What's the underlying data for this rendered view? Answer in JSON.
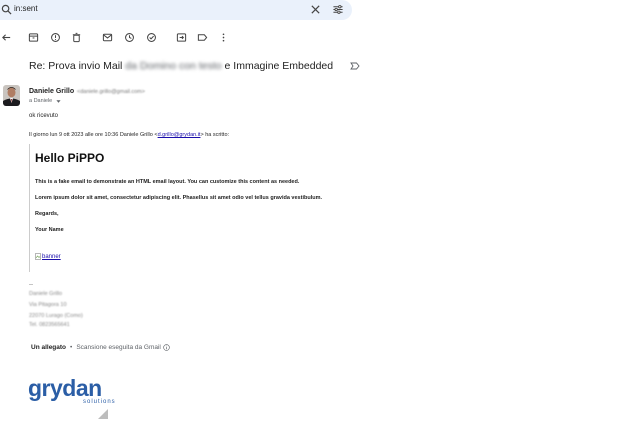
{
  "search": {
    "query": "in:sent"
  },
  "email": {
    "subject": {
      "part1": "Re: Prova invio Mail",
      "part2_obscured": "da Domino con testo",
      "part3": "e Immagine Embedded"
    },
    "sender": {
      "name": "Daniele Grillo",
      "email": "<daniele.grillo@gmail.com>"
    },
    "recipient": "a Daniele",
    "reply_body": "ok ricevuto",
    "quote_header": {
      "prefix": "Il giorno lun 9 ott 2023 alle ore 10:36 Daniele Grillo <",
      "link": "d.grillo@grydan.it",
      "suffix": "> ha scritto:"
    },
    "quoted": {
      "title": "Hello PiPPO",
      "line1": "This is a fake email to demonstrate an HTML email layout. You can customize this content as needed.",
      "line2": "Lorem ipsum dolor sit amet, consectetur adipiscing elit. Phasellus sit amet odio vel tellus gravida vestibulum.",
      "regards": "Regards,",
      "your_name": "Your Name",
      "banner_alt": "banner"
    },
    "signature": {
      "dash": "--",
      "line1": "Daniele Grillo",
      "line2": "Via Pitagora 10",
      "line3": "22070 Lurago (Como)",
      "line4": "Tel. 0823565641"
    },
    "attachments": {
      "count_label": "Un allegato",
      "separator": "•",
      "scan_label": "Scansione eseguita da Gmail"
    },
    "logo": {
      "brand": "grydan",
      "tagline": "solutions"
    }
  },
  "colors": {
    "search_bg": "#eaf1fb",
    "link": "#1a0dab",
    "logo_blue": "#2b5ea6"
  }
}
